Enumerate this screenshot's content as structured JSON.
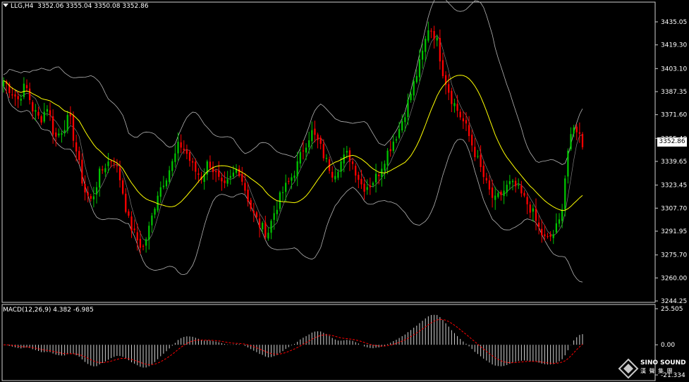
{
  "header": {
    "symbol": "LLG,H4",
    "ohlc": "3352.06 3355.04 3350.08 3352.86"
  },
  "macd_header": {
    "label": "MACD(12,26,9) 4.382 -6.985"
  },
  "current_price": "3352.86",
  "logo": {
    "en": "SINO SOUND",
    "cn": "漢 聲 集 團"
  },
  "colors": {
    "up": "#00c400",
    "down": "#ff0000",
    "bands": "#b4b4b4",
    "ma": "#ffff00",
    "macd_signal": "#ff0000",
    "macd_hist": "#d0d0d0",
    "background": "#000000"
  },
  "chart_data": [
    {
      "type": "candlestick",
      "symbol": "LLG",
      "timeframe": "H4",
      "y_tick_labels": [
        "3435.05",
        "3419.30",
        "3403.10",
        "3387.35",
        "3371.60",
        "3355.40",
        "3339.65",
        "3323.45",
        "3307.70",
        "3291.95",
        "3275.70",
        "3260.00",
        "3244.25"
      ],
      "ylim": [
        3244.25,
        3443.0
      ],
      "grid": false,
      "overlays": [
        "bollinger_bands",
        "moving_average"
      ],
      "close_path": [
        3395,
        3388,
        3382,
        3392,
        3375,
        3368,
        3378,
        3355,
        3362,
        3370,
        3345,
        3320,
        3312,
        3330,
        3338,
        3342,
        3326,
        3300,
        3288,
        3280,
        3296,
        3318,
        3328,
        3338,
        3352,
        3345,
        3334,
        3329,
        3340,
        3330,
        3320,
        3328,
        3336,
        3320,
        3304,
        3296,
        3290,
        3306,
        3318,
        3326,
        3336,
        3350,
        3360,
        3352,
        3340,
        3331,
        3339,
        3345,
        3334,
        3322,
        3324,
        3330,
        3342,
        3352,
        3362,
        3377,
        3393,
        3410,
        3432,
        3425,
        3400,
        3384,
        3374,
        3364,
        3350,
        3336,
        3322,
        3312,
        3318,
        3324,
        3322,
        3314,
        3307,
        3294,
        3285,
        3290,
        3300,
        3347,
        3365,
        3352
      ]
    },
    {
      "type": "bar",
      "name": "MACD(12,26,9)",
      "macd": 4.382,
      "signal": -6.985,
      "y_tick_labels": [
        "25.505",
        "0.00",
        "-21.334"
      ],
      "ylim": [
        -21.334,
        25.505
      ]
    }
  ]
}
